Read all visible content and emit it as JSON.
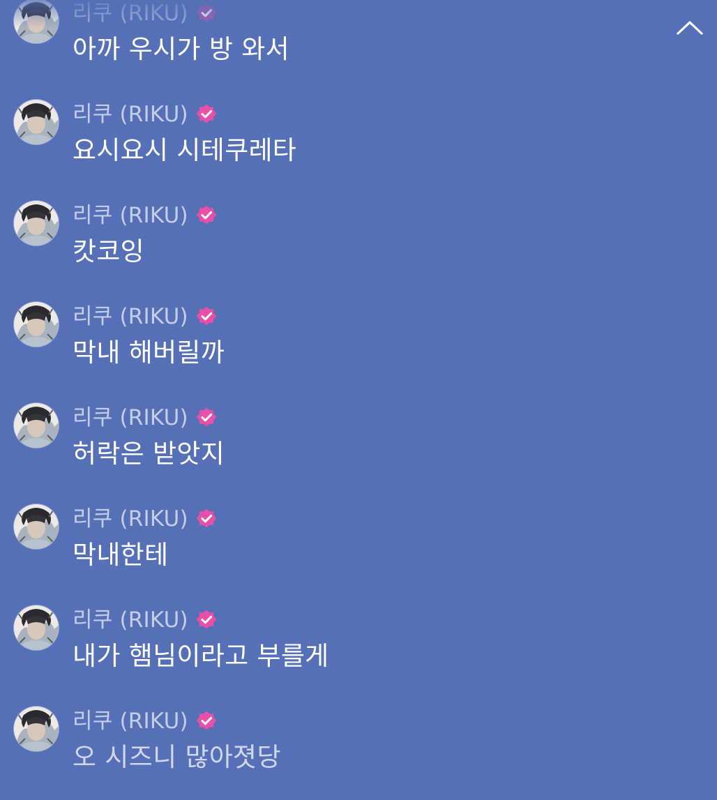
{
  "colors": {
    "background": "#5670b7",
    "verified_badge": "#e84fa9",
    "message_text": "#ffffff",
    "sender_text": "rgba(255,255,255,0.66)"
  },
  "sender": {
    "name": "리쿠 (RIKU)",
    "verified": true,
    "badge_icon": "verified-check-icon"
  },
  "header": {
    "collapse_icon": "chevron-up-icon"
  },
  "messages": [
    {
      "sender": "리쿠 (RIKU)",
      "text": "아까 우시가 방 와서"
    },
    {
      "sender": "리쿠 (RIKU)",
      "text": "요시요시 시테쿠레타"
    },
    {
      "sender": "리쿠 (RIKU)",
      "text": "캇코잉"
    },
    {
      "sender": "리쿠 (RIKU)",
      "text": "막내 해버릴까"
    },
    {
      "sender": "리쿠 (RIKU)",
      "text": "허락은 받앗지"
    },
    {
      "sender": "리쿠 (RIKU)",
      "text": "막내한테"
    },
    {
      "sender": "리쿠 (RIKU)",
      "text": "내가 햄님이라고 부를게"
    },
    {
      "sender": "리쿠 (RIKU)",
      "text": "오 시즈니 많아졋당"
    }
  ]
}
